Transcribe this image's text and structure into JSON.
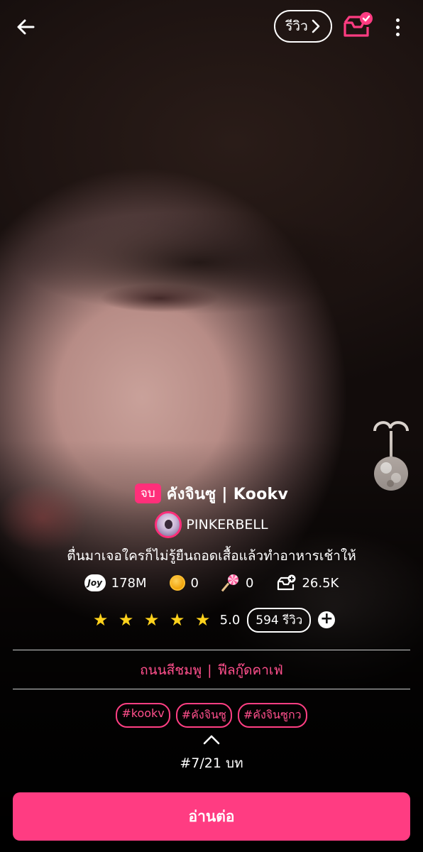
{
  "header": {
    "review_label": "รีวิว"
  },
  "novel": {
    "status_badge": "จบ",
    "title": "คังจินซู | Kookv",
    "author": "PINKERBELL",
    "tagline": "ตื่นมาเจอใครก็ไม่รู้ยืนถอดเสื้อแล้วทำอาหารเช้าให้",
    "category_left": "ถนนสีชมพู",
    "category_separator": "|",
    "category_right": "ฟีลกู๊ดคาเฟ่"
  },
  "stats": {
    "joy_icon_text": "Joy",
    "views": "178M",
    "coins": "0",
    "lollipops": "0",
    "shelf_adds": "26.5K"
  },
  "rating": {
    "stars": 5,
    "value": "5.0",
    "review_count": "594 รีวิว"
  },
  "tags": [
    "#kookv",
    "#คังจินซู",
    "#คังจินซูกว"
  ],
  "chapter_progress": "#7/21 บท",
  "read_button": "อ่านต่อ",
  "colors": {
    "accent": "#ff3c82",
    "star": "#ffd21c",
    "tag_text": "#ff4f8c"
  },
  "icons": [
    "back-arrow-icon",
    "chevron-right-icon",
    "bookshelf-check-icon",
    "more-vertical-icon",
    "joy-icon",
    "coin-icon",
    "lollipop-icon",
    "shelf-add-icon",
    "star-icon",
    "plus-icon",
    "chevron-up-icon"
  ]
}
